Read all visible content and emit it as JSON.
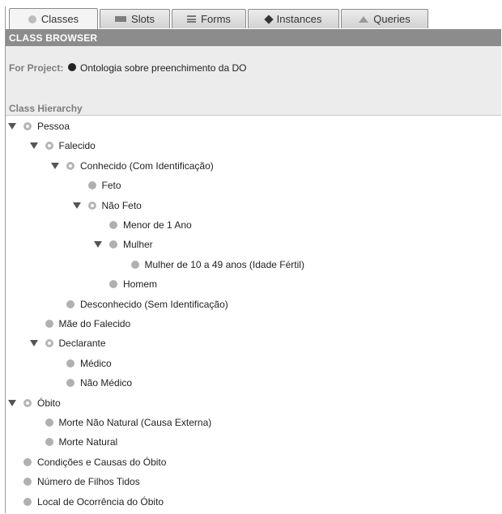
{
  "tabs": [
    {
      "label": "Classes",
      "icon": "class-icon",
      "active": true
    },
    {
      "label": "Slots",
      "icon": "slot-icon",
      "active": false
    },
    {
      "label": "Forms",
      "icon": "form-icon",
      "active": false
    },
    {
      "label": "Instances",
      "icon": "instance-icon",
      "active": false
    },
    {
      "label": "Queries",
      "icon": "query-icon",
      "active": false
    }
  ],
  "browser": {
    "title": "CLASS BROWSER",
    "project_label": "For Project:",
    "project_name": "Ontologia sobre preenchimento da DO",
    "hierarchy_label": "Class Hierarchy"
  },
  "tree": [
    {
      "label": "Pessoa",
      "level": 0,
      "expanded": true,
      "abstract": true
    },
    {
      "label": "Falecido",
      "level": 1,
      "expanded": true,
      "abstract": true
    },
    {
      "label": "Conhecido (Com Identificação)",
      "level": 2,
      "expanded": true,
      "abstract": true
    },
    {
      "label": "Feto",
      "level": 3,
      "expanded": false,
      "abstract": false
    },
    {
      "label": "Não Feto",
      "level": 3,
      "expanded": true,
      "abstract": true
    },
    {
      "label": "Menor de 1 Ano",
      "level": 4,
      "expanded": false,
      "abstract": false
    },
    {
      "label": "Mulher",
      "level": 4,
      "expanded": true,
      "abstract": false
    },
    {
      "label": "Mulher de 10 a 49 anos (Idade Fértil)",
      "level": 5,
      "expanded": false,
      "abstract": false
    },
    {
      "label": "Homem",
      "level": 4,
      "expanded": false,
      "abstract": false
    },
    {
      "label": "Desconhecido (Sem Identificação)",
      "level": 2,
      "expanded": false,
      "abstract": false
    },
    {
      "label": "Mãe do Falecido",
      "level": 1,
      "expanded": false,
      "abstract": false
    },
    {
      "label": "Declarante",
      "level": 1,
      "expanded": true,
      "abstract": true
    },
    {
      "label": "Médico",
      "level": 2,
      "expanded": false,
      "abstract": false
    },
    {
      "label": "Não Médico",
      "level": 2,
      "expanded": false,
      "abstract": false
    },
    {
      "label": "Óbito",
      "level": 0,
      "expanded": true,
      "abstract": true
    },
    {
      "label": "Morte Não Natural (Causa Externa)",
      "level": 1,
      "expanded": false,
      "abstract": false
    },
    {
      "label": "Morte Natural",
      "level": 1,
      "expanded": false,
      "abstract": false
    },
    {
      "label": "Condições e Causas do Óbito",
      "level": 0,
      "expanded": false,
      "abstract": false
    },
    {
      "label": "Número de Filhos Tidos",
      "level": 0,
      "expanded": false,
      "abstract": false
    },
    {
      "label": "Local de Ocorrência do Óbito",
      "level": 0,
      "expanded": false,
      "abstract": false
    }
  ]
}
